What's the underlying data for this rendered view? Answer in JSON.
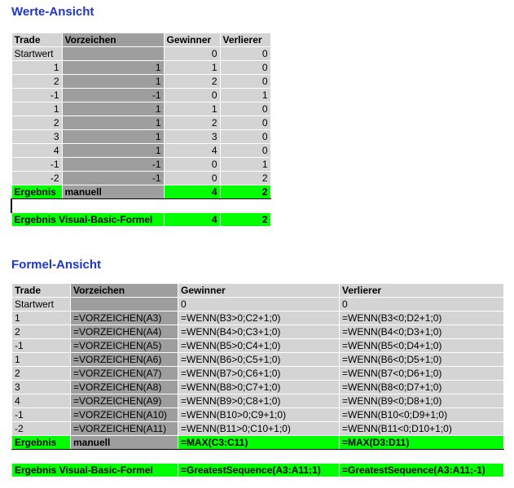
{
  "werte": {
    "title": "Werte-Ansicht",
    "headers": [
      "Trade",
      "Vorzeichen",
      "Gewinner",
      "Verlierer"
    ],
    "start_row": [
      "Startwert",
      "",
      "0",
      "0"
    ],
    "rows": [
      [
        "1",
        "1",
        "1",
        "0"
      ],
      [
        "2",
        "1",
        "2",
        "0"
      ],
      [
        "-1",
        "-1",
        "0",
        "1"
      ],
      [
        "1",
        "1",
        "1",
        "0"
      ],
      [
        "2",
        "1",
        "2",
        "0"
      ],
      [
        "3",
        "1",
        "3",
        "0"
      ],
      [
        "4",
        "1",
        "4",
        "0"
      ],
      [
        "-1",
        "-1",
        "0",
        "1"
      ],
      [
        "-2",
        "-1",
        "0",
        "2"
      ]
    ],
    "ergebnis_row": [
      "Ergebnis",
      "manuell",
      "4",
      "2"
    ],
    "vba_row": [
      "Ergebnis Visual-Basic-Formel",
      "4",
      "2"
    ]
  },
  "formel": {
    "title": "Formel-Ansicht",
    "headers": [
      "Trade",
      "Vorzeichen",
      "Gewinner",
      "Verlierer"
    ],
    "start_row": [
      "Startwert",
      "",
      "0",
      "0"
    ],
    "rows": [
      [
        "1",
        "=VORZEICHEN(A3)",
        "=WENN(B3>0;C2+1;0)",
        "=WENN(B3<0;D2+1;0)"
      ],
      [
        "2",
        "=VORZEICHEN(A4)",
        "=WENN(B4>0;C3+1;0)",
        "=WENN(B4<0;D3+1;0)"
      ],
      [
        "-1",
        "=VORZEICHEN(A5)",
        "=WENN(B5>0;C4+1;0)",
        "=WENN(B5<0;D4+1;0)"
      ],
      [
        "1",
        "=VORZEICHEN(A6)",
        "=WENN(B6>0;C5+1;0)",
        "=WENN(B6<0;D5+1;0)"
      ],
      [
        "2",
        "=VORZEICHEN(A7)",
        "=WENN(B7>0;C6+1;0)",
        "=WENN(B7<0;D6+1;0)"
      ],
      [
        "3",
        "=VORZEICHEN(A8)",
        "=WENN(B8>0;C7+1;0)",
        "=WENN(B8<0;D7+1;0)"
      ],
      [
        "4",
        "=VORZEICHEN(A9)",
        "=WENN(B9>0;C8+1;0)",
        "=WENN(B9<0;D8+1;0)"
      ],
      [
        "-1",
        "=VORZEICHEN(A10)",
        "=WENN(B10>0;C9+1;0)",
        "=WENN(B10<0;D9+1;0)"
      ],
      [
        "-2",
        "=VORZEICHEN(A11)",
        "=WENN(B11>0;C10+1;0)",
        "=WENN(B11<0;D10+1;0)"
      ]
    ],
    "ergebnis_row": [
      "Ergebnis",
      "manuell",
      "=MAX(C3:C11)",
      "=MAX(D3:D11)"
    ],
    "vba_row": [
      "Ergebnis Visual-Basic-Formel",
      "=GreatestSequence(A3:A11;1)",
      "=GreatestSequence(A3:A11;-1)"
    ]
  },
  "colors": {
    "title": "#1f35c8",
    "cell": "#d4d4d4",
    "dark": "#9e9e9e",
    "green": "#00ff00"
  }
}
